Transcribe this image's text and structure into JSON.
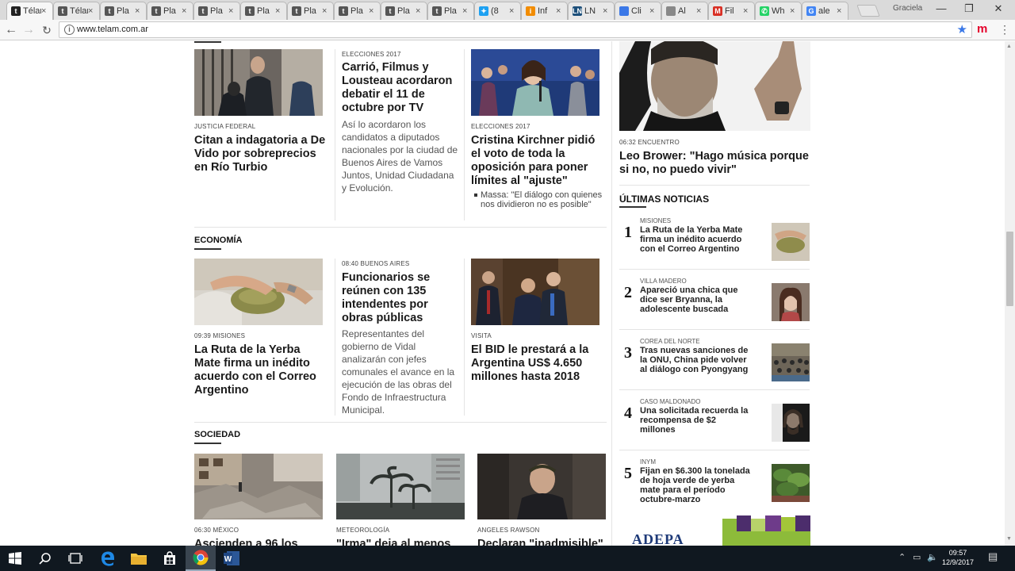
{
  "browser": {
    "tabs": [
      {
        "title": "Télam",
        "favicon": "telam-icon",
        "color": "#222222",
        "letter": "t"
      },
      {
        "title": "Télam",
        "favicon": "telam-icon",
        "color": "#555555",
        "letter": "t"
      },
      {
        "title": "Pla",
        "favicon": "telam-icon",
        "color": "#555555",
        "letter": "t"
      },
      {
        "title": "Pla",
        "favicon": "telam-icon",
        "color": "#555555",
        "letter": "t"
      },
      {
        "title": "Pla",
        "favicon": "telam-icon",
        "color": "#555555",
        "letter": "t"
      },
      {
        "title": "Pla",
        "favicon": "telam-icon",
        "color": "#555555",
        "letter": "t"
      },
      {
        "title": "Pla",
        "favicon": "telam-icon",
        "color": "#555555",
        "letter": "t"
      },
      {
        "title": "Pla",
        "favicon": "telam-icon",
        "color": "#555555",
        "letter": "t"
      },
      {
        "title": "Pla",
        "favicon": "telam-icon",
        "color": "#555555",
        "letter": "t"
      },
      {
        "title": "Pla",
        "favicon": "telam-icon",
        "color": "#555555",
        "letter": "t"
      },
      {
        "title": "(8",
        "favicon": "twitter-icon",
        "color": "#1da1f2",
        "letter": "✦"
      },
      {
        "title": "Inf",
        "favicon": "infobae-icon",
        "color": "#f28c00",
        "letter": "i"
      },
      {
        "title": "LN",
        "favicon": "lanacion-icon",
        "color": "#1c4f7a",
        "letter": "LN"
      },
      {
        "title": "Cli",
        "favicon": "loading-icon",
        "color": "#3b78e7",
        "letter": ""
      },
      {
        "title": "Al",
        "favicon": "document-icon",
        "color": "#888888",
        "letter": ""
      },
      {
        "title": "Fil",
        "favicon": "gmail-icon",
        "color": "#d93025",
        "letter": "M"
      },
      {
        "title": "Wh",
        "favicon": "whatsapp-icon",
        "color": "#25d366",
        "letter": "✆"
      },
      {
        "title": "ale",
        "favicon": "google-icon",
        "color": "#4285f4",
        "letter": "G"
      }
    ],
    "profile": "Graciela",
    "url": "www.telam.com.ar"
  },
  "top_stories": {
    "left": {
      "kicker": "JUSTICIA FEDERAL",
      "headline": "Citan a indagatoria a De Vido por sobreprecios en Río Turbio"
    },
    "middle": {
      "kicker": "ELECCIONES 2017",
      "headline": "Carrió, Filmus y Lousteau acordaron debatir el 11 de octubre por TV",
      "summary": "Así lo acordaron los candidatos a diputados nacionales por la ciudad de Buenos Aires de Vamos Juntos, Unidad Ciudadana y Evolución."
    },
    "right": {
      "kicker": "ELECCIONES 2017",
      "headline": "Cristina Kirchner pidió el voto de toda la oposición para poner límites al \"ajuste\"",
      "bullet": "Massa: \"El diálogo con quienes nos dividieron no es posible\""
    }
  },
  "economia": {
    "section": "ECONOMÍA",
    "left": {
      "kicker": "09:39 MISIONES",
      "headline": "La Ruta de la Yerba Mate firma un inédito acuerdo con el Correo Argentino"
    },
    "middle": {
      "kicker": "08:40 BUENOS AIRES",
      "headline": "Funcionarios se reúnen con 135 intendentes por obras públicas",
      "summary": "Representantes del gobierno de Vidal analizarán con jefes comunales el avance en la ejecución de las obras del Fondo de Infraestructura Municipal."
    },
    "right": {
      "kicker": "VISITA",
      "headline": "El BID le prestará a la Argentina US$ 4.650 millones hasta 2018"
    }
  },
  "sociedad": {
    "section": "SOCIEDAD",
    "items": [
      {
        "kicker": "06:30 MÉXICO",
        "headline": "Ascienden a 96 los"
      },
      {
        "kicker": "METEOROLOGÍA",
        "headline": "\"Irma\" deja al menos"
      },
      {
        "kicker": "ANGELES RAWSON",
        "headline": "Declaran \"inadmisible\""
      }
    ]
  },
  "sidebar": {
    "feature": {
      "kicker": "06:32 ENCUENTRO",
      "headline": "Leo Brower: \"Hago música porque si no, no puedo vivir\""
    },
    "latest_title": "ÚLTIMAS NOTICIAS",
    "latest": [
      {
        "num": "1",
        "kicker": "MISIONES",
        "title": "La Ruta de la Yerba Mate firma un inédito acuerdo con el Correo Argentino"
      },
      {
        "num": "2",
        "kicker": "VILLA MADERO",
        "title": "Apareció una chica que dice ser Bryanna, la adolescente buscada"
      },
      {
        "num": "3",
        "kicker": "COREA DEL NORTE",
        "title": "Tras nuevas sanciones de la ONU, China pide volver al diálogo con Pyongyang"
      },
      {
        "num": "4",
        "kicker": "CASO MALDONADO",
        "title": "Una solicitada recuerda la recompensa de $2 millones"
      },
      {
        "num": "5",
        "kicker": "INYM",
        "title": "Fijan en $6.300 la tonelada de hoja verde de yerba mate para el período octubre-marzo"
      }
    ],
    "ad_text": "ADEPA"
  },
  "taskbar": {
    "time": "09:57",
    "date": "12/9/2017"
  }
}
